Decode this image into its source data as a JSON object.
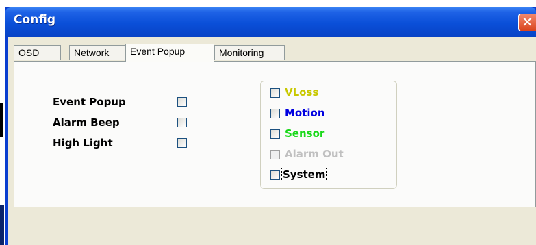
{
  "window": {
    "title": "Config",
    "close_glyph": "✕"
  },
  "tabs": [
    {
      "label": "OSD",
      "active": false
    },
    {
      "label": "Network",
      "active": false
    },
    {
      "label": "Event Popup",
      "active": true
    },
    {
      "label": "Monitoring",
      "active": false
    }
  ],
  "event_popup": {
    "options": [
      {
        "label": "Event Popup",
        "checked": false
      },
      {
        "label": "Alarm Beep",
        "checked": false
      },
      {
        "label": "High Light",
        "checked": false
      }
    ],
    "event_types": [
      {
        "label": "VLoss",
        "color": "#c8c800",
        "checked": false,
        "enabled": true
      },
      {
        "label": "Motion",
        "color": "#0000e0",
        "checked": false,
        "enabled": true
      },
      {
        "label": "Sensor",
        "color": "#18d818",
        "checked": false,
        "enabled": true
      },
      {
        "label": "Alarm Out",
        "color": "#c0c0c0",
        "checked": false,
        "enabled": false
      },
      {
        "label": "System",
        "color": "#000000",
        "checked": false,
        "enabled": true,
        "focused": true
      }
    ]
  }
}
